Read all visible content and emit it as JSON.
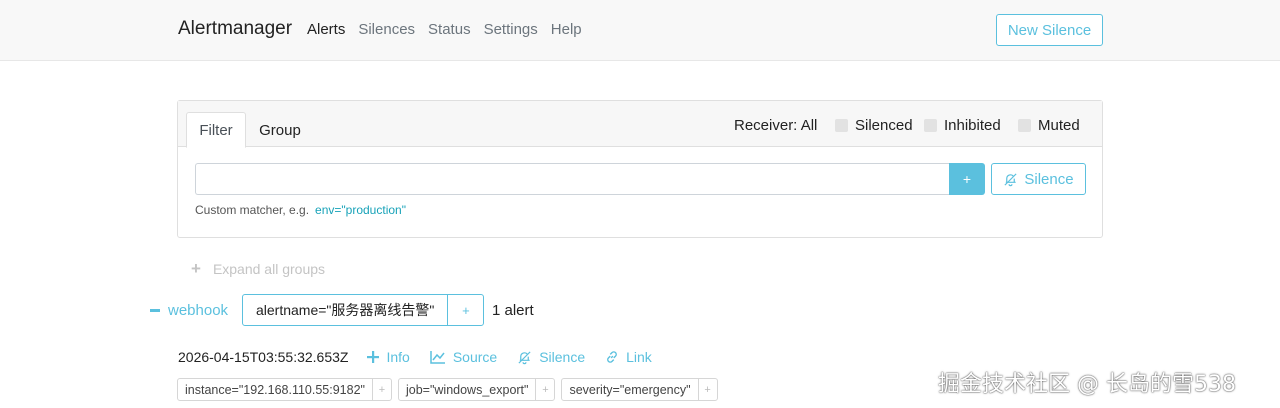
{
  "navbar": {
    "brand": "Alertmanager",
    "items": [
      "Alerts",
      "Silences",
      "Status",
      "Settings",
      "Help"
    ],
    "active": "Alerts",
    "new_silence": "New Silence"
  },
  "filter_card": {
    "tabs": [
      "Filter",
      "Group"
    ],
    "receiver": "Receiver: All",
    "checkboxes": [
      "Silenced",
      "Inhibited",
      "Muted"
    ],
    "input_value": "",
    "add_button": "+",
    "silence_button": "Silence",
    "hint_text": "Custom matcher, e.g.",
    "hint_example": "env=\"production\""
  },
  "expand_all": "Expand all groups",
  "group": {
    "receiver": "webhook",
    "label": "alertname=\"服务器离线告警\"",
    "add": "+",
    "count": "1 alert"
  },
  "alert": {
    "timestamp": "2026-04-15T03:55:32.653Z",
    "actions": [
      {
        "label": "Info",
        "icon": "plus-icon"
      },
      {
        "label": "Source",
        "icon": "chart-line-icon"
      },
      {
        "label": "Silence",
        "icon": "bell-slash-icon"
      },
      {
        "label": "Link",
        "icon": "link-icon"
      }
    ],
    "labels": [
      "instance=\"192.168.110.55:9182\"",
      "job=\"windows_export\"",
      "severity=\"emergency\""
    ],
    "label_add": "+"
  },
  "watermark": "掘金技术社区 @ 长岛的雪538",
  "colors": {
    "accent": "#5bc0de",
    "link": "#17a2b8",
    "navbar_bg": "#f8f8f8"
  }
}
